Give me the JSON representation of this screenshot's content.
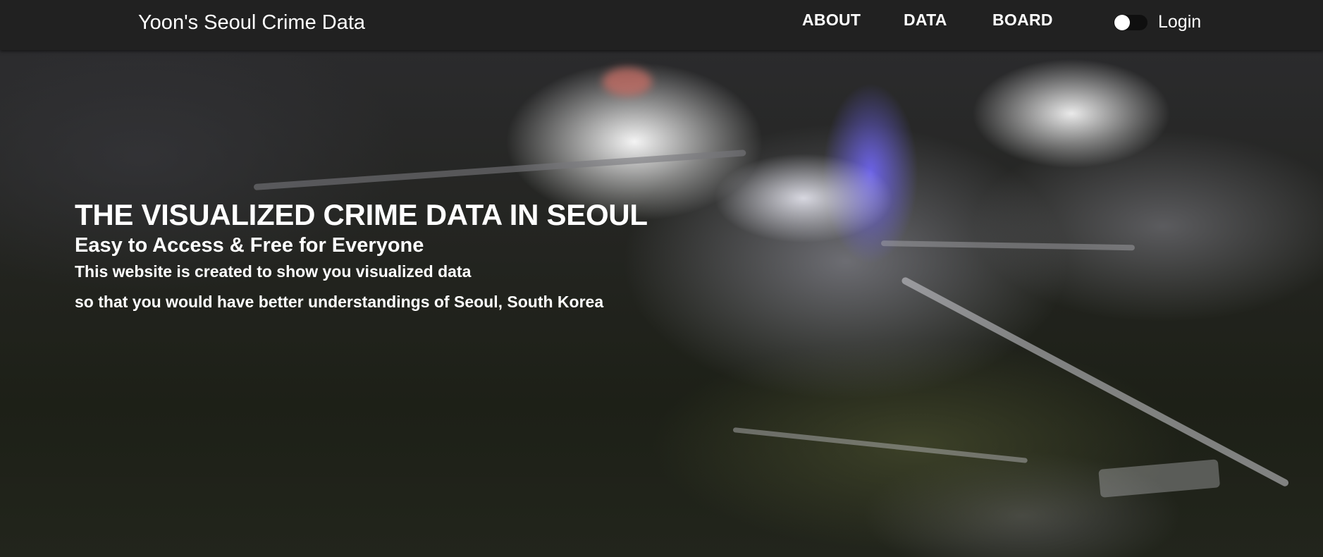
{
  "navbar": {
    "brand": "Yoon's Seoul Crime Data",
    "links": [
      {
        "label": "ABOUT"
      },
      {
        "label": "DATA"
      },
      {
        "label": "BOARD"
      }
    ],
    "theme_toggle": {
      "state": "off"
    },
    "login_label": "Login",
    "background_color": "#212121"
  },
  "hero": {
    "title": "THE VISUALIZED CRIME DATA IN SEOUL",
    "subtitle": "Easy to Access & Free for Everyone",
    "description_line1": "This website is created to show you visualized data",
    "description_line2": "so that you would have better understandings of Seoul, South Korea",
    "background": "blurred night video of police scene"
  }
}
